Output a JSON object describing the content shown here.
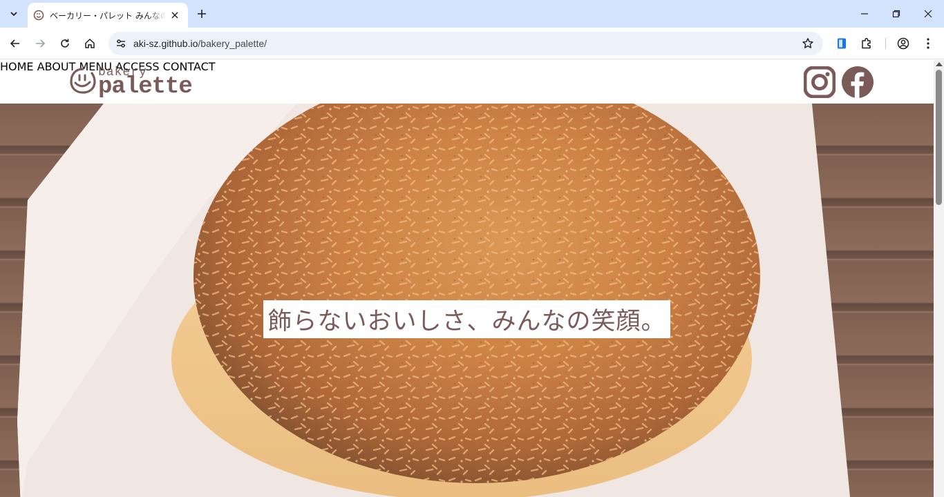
{
  "browser": {
    "tab_title": "ベーカリー・パレット みんなのパン屋さん",
    "url_host": "aki-sz.github.io",
    "url_path": "/bakery_palette/"
  },
  "site": {
    "logo_top": "bakery",
    "logo_bottom": "palette",
    "nav": [
      "HOME",
      "ABOUT",
      "MENU",
      "ACCESS",
      "CONTACT"
    ],
    "social": [
      "instagram-icon",
      "facebook-icon"
    ],
    "catch_copy": "飾らないおいしさ、みんなの笑顔。"
  },
  "colors": {
    "brand": "#7b5a5a",
    "tabbar": "#d3e3fd",
    "omnibox": "#edf2fa"
  }
}
